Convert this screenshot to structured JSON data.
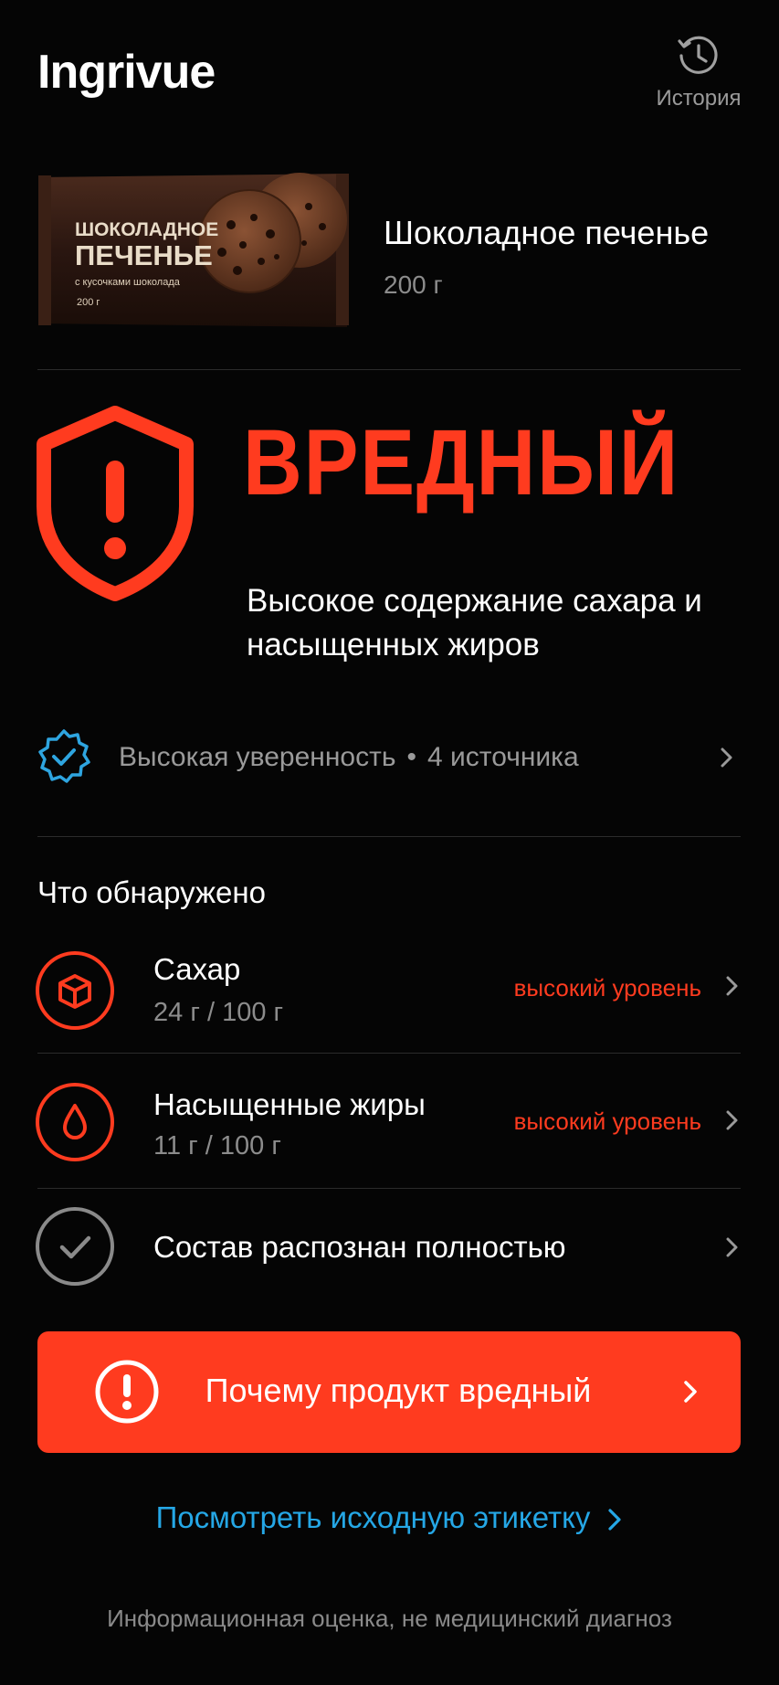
{
  "app": {
    "logo": "Ingrivue"
  },
  "header": {
    "history_label": "История"
  },
  "product": {
    "name": "Шоколадное печенье",
    "weight": "200 г",
    "pack": {
      "line1": "ШОКОЛАДНОЕ",
      "line2": "ПЕЧЕНЬЕ",
      "line3": "с кусочками шоколада",
      "line4": "200 г"
    }
  },
  "verdict": {
    "label": "ВРЕДНЫЙ",
    "description": "Высокое содержание сахара и насыщенных жиров"
  },
  "confidence": {
    "text": "Высокая уверенность",
    "separator": "•",
    "sources": "4 источника"
  },
  "findings": {
    "title": "Что обнаружено",
    "items": [
      {
        "name": "Сахар",
        "value": "24 г / 100 г",
        "level": "высокий уровень",
        "icon": "cube-icon"
      },
      {
        "name": "Насыщенные жиры",
        "value": "11 г / 100 г",
        "level": "высокий уровень",
        "icon": "drop-icon"
      },
      {
        "name": "Состав распознан полностью",
        "icon": "check-icon"
      }
    ]
  },
  "cta": {
    "label": "Почему продукт вредный"
  },
  "link": {
    "label": "Посмотреть исходную этикетку"
  },
  "footnote": "Информационная оценка, не медицинский диагноз",
  "colors": {
    "accent": "#ff3b1f",
    "link": "#25a7e6",
    "background": "#050505"
  }
}
